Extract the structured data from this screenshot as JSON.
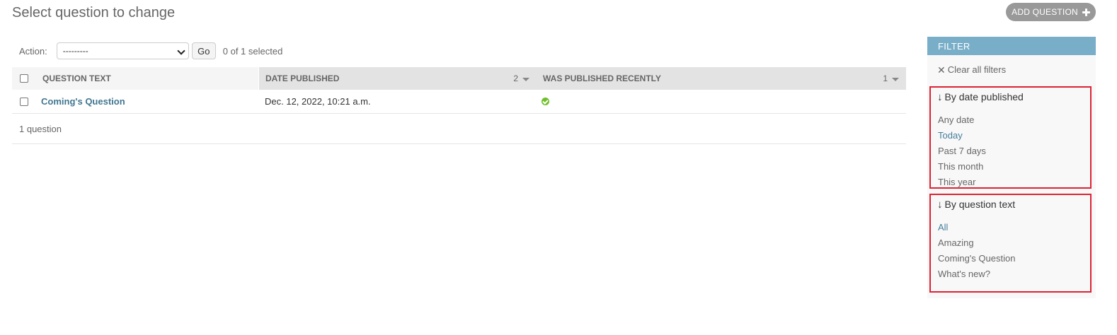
{
  "page": {
    "title": "Select question to change",
    "add_button_label": "ADD QUESTION"
  },
  "actions": {
    "label": "Action:",
    "selected_option": "---------",
    "go_label": "Go",
    "selection_count": "0 of 1 selected"
  },
  "table": {
    "columns": [
      {
        "label": "QUESTION TEXT",
        "sort_priority": ""
      },
      {
        "label": "DATE PUBLISHED",
        "sort_priority": "2"
      },
      {
        "label": "WAS PUBLISHED RECENTLY",
        "sort_priority": "1"
      }
    ],
    "rows": [
      {
        "question_text": "Coming's Question",
        "date_published": "Dec. 12, 2022, 10:21 a.m.",
        "was_published_recently": true
      }
    ],
    "paginator": "1 question"
  },
  "filter": {
    "header": "FILTER",
    "clear_label": "Clear all filters",
    "groups": [
      {
        "title": "By date published",
        "choices": [
          "Any date",
          "Today",
          "Past 7 days",
          "This month",
          "This year"
        ],
        "selected": "Today"
      },
      {
        "title": "By question text",
        "choices": [
          "All",
          "Amazing",
          "Coming's Question",
          "What's new?"
        ],
        "selected": "All"
      }
    ]
  },
  "colors": {
    "filter_header_bg": "#79aec8",
    "link": "#417690",
    "highlight_border": "#dd2233",
    "yes_icon": "#70bf2b"
  }
}
